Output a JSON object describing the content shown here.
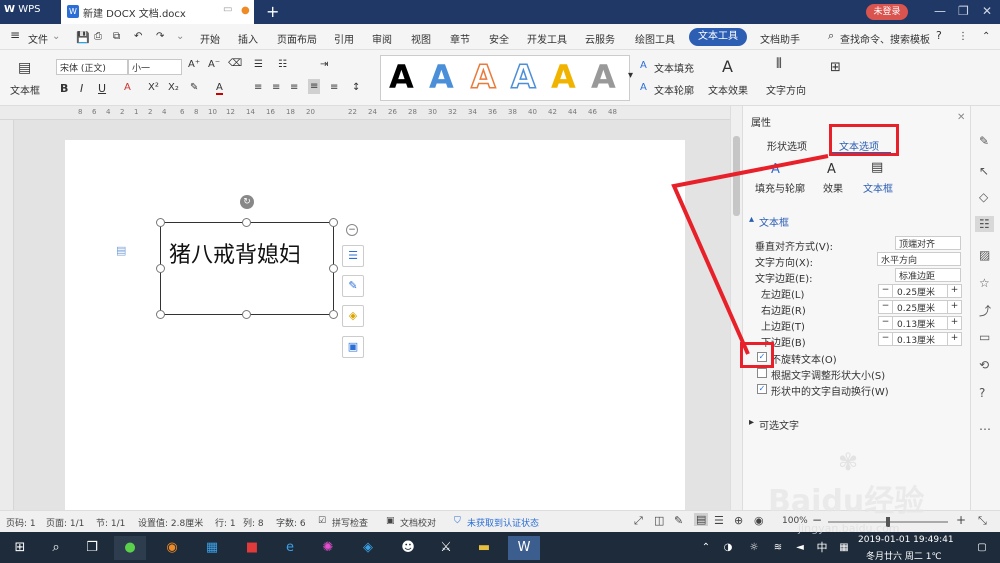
{
  "titlebar": {
    "app_name": "WPS",
    "doc_tab": "新建 DOCX 文档.docx",
    "login": "未登录",
    "new_tab_plus": "+"
  },
  "menubar": {
    "file": "文件",
    "items": [
      "开始",
      "插入",
      "页面布局",
      "引用",
      "审阅",
      "视图",
      "章节",
      "安全",
      "开发工具",
      "云服务",
      "绘图工具",
      "文本工具",
      "文档助手"
    ],
    "search": "查找命令、搜索模板"
  },
  "ribbon": {
    "textbox": "文本框",
    "font": "宋体 (正文)",
    "size": "小一",
    "bold": "B",
    "italic": "I",
    "underline": "U",
    "text_fill": "文本填充",
    "text_outline": "文本轮廓",
    "text_effect": "文本效果",
    "text_direction": "文字方向",
    "art_A": "A"
  },
  "ruler": {
    "numbers": [
      "8",
      "6",
      "4",
      "2",
      "1",
      "2",
      "4",
      "6",
      "8",
      "10",
      "12",
      "14",
      "16",
      "18",
      "20",
      "22",
      "24",
      "26",
      "28",
      "30",
      "32",
      "34",
      "36",
      "38",
      "40",
      "42",
      "44",
      "46",
      "48"
    ]
  },
  "document": {
    "textbox_text": "猪八戒背媳妇"
  },
  "panel": {
    "title": "属性",
    "tab_shape": "形状选项",
    "tab_text": "文本选项",
    "sub_fill": "填充与轮廓",
    "sub_effect": "效果",
    "sub_textbox": "文本框",
    "section_textbox": "文本框",
    "valign_label": "垂直对齐方式(V):",
    "valign_value": "顶端对齐",
    "direction_label": "文字方向(X):",
    "direction_value": "水平方向",
    "margin_label": "文字边距(E):",
    "margin_value": "标准边距",
    "left_label": "左边距(L)",
    "left_value": "0.25厘米",
    "right_label": "右边距(R)",
    "right_value": "0.25厘米",
    "top_label": "上边距(T)",
    "top_value": "0.13厘米",
    "bottom_label": "下边距(B)",
    "bottom_value": "0.13厘米",
    "no_rotate": "不旋转文本(O)",
    "no_rotate_checked": true,
    "autofit": "根据文字调整形状大小(S)",
    "autofit_checked": false,
    "wrap": "形状中的文字自动换行(W)",
    "wrap_checked": true,
    "alt_text": "可选文字"
  },
  "statusbar": {
    "page_code": "页码: 1",
    "page": "页面: 1/1",
    "section": "节: 1/1",
    "setting": "设置值: 2.8厘米",
    "row": "行: 1",
    "col": "列: 8",
    "words": "字数: 6",
    "spell": "拼写检查",
    "proof": "文档校对",
    "cert": "未获取到认证状态",
    "zoom": "100%"
  },
  "taskbar": {
    "input_lang": "中",
    "time": "2019-01-01 19:49:41",
    "date": "冬月廿六 周二 1℃"
  },
  "watermark": {
    "text": "Baidu经验",
    "url": "jingyan.baidu.com"
  },
  "colors": {
    "title_bar": "#1f3865",
    "accent": "#2c5fb4",
    "highlight_red": "#e8202a"
  }
}
